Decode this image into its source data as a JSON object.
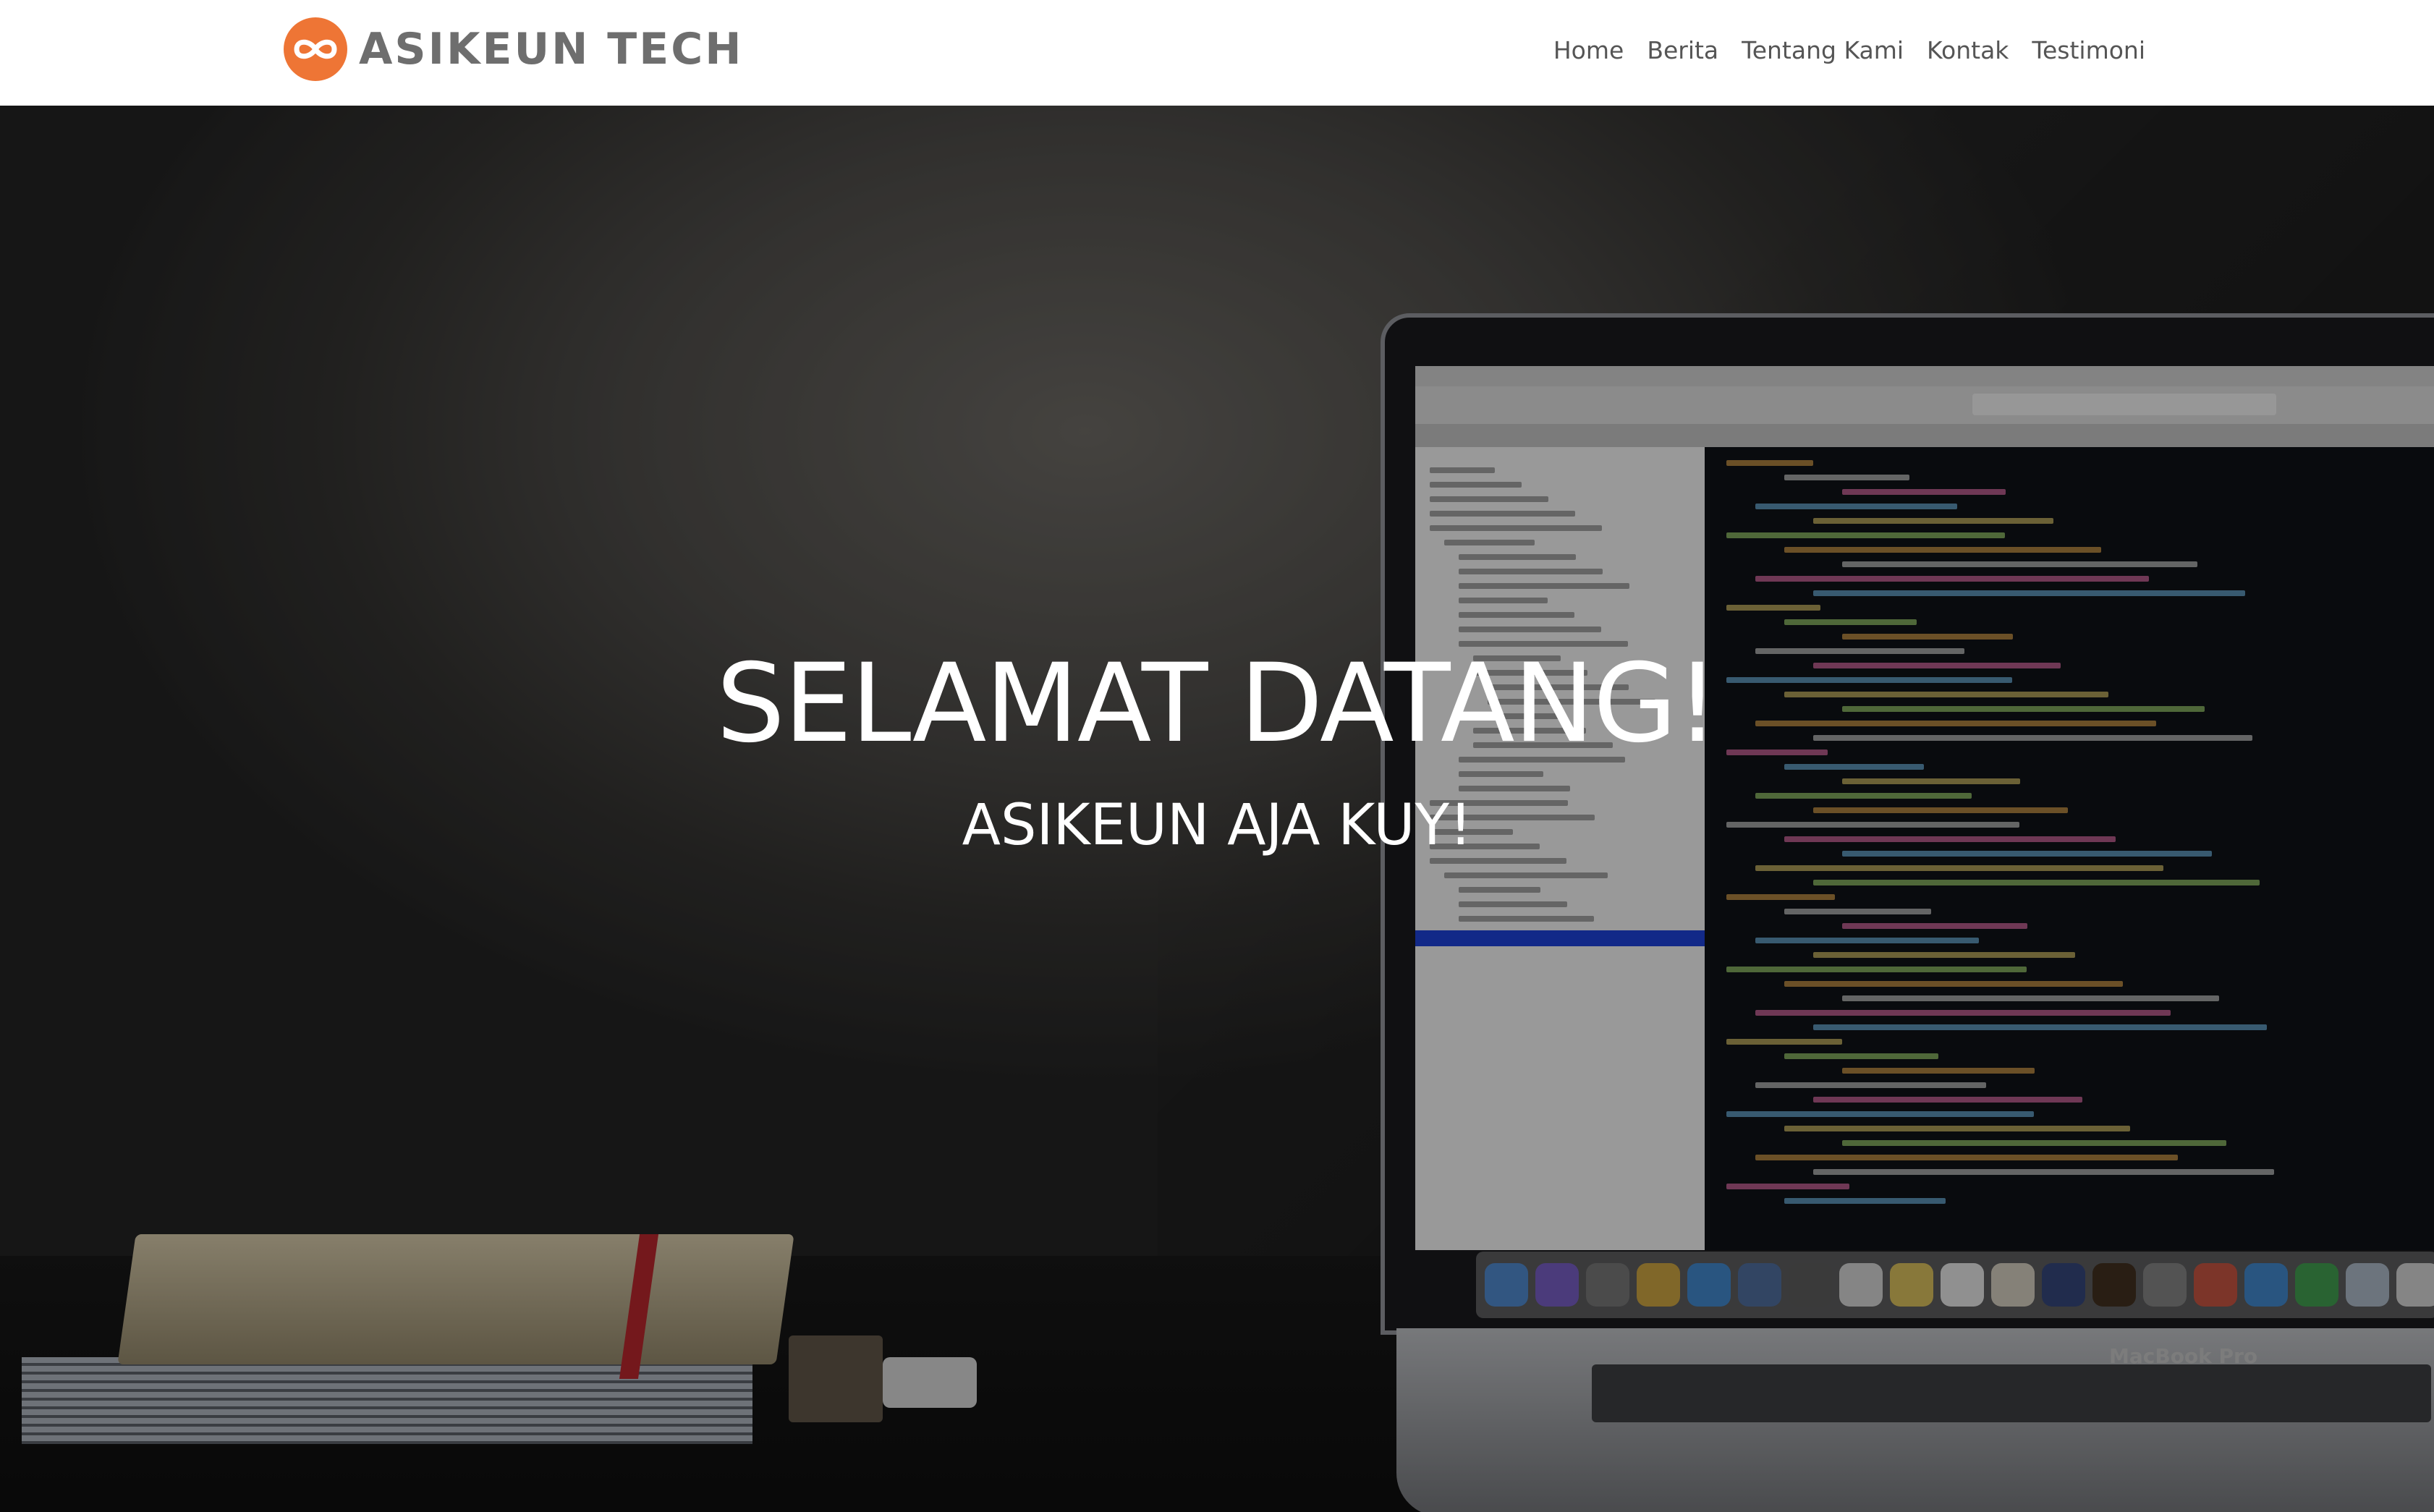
{
  "brand": {
    "name": "ASIKEUN TECH",
    "logo_icon": "infinity-icon",
    "logo_color": "#ee7535"
  },
  "nav": {
    "items": [
      {
        "label": "Home"
      },
      {
        "label": "Berita"
      },
      {
        "label": "Tentang Kami"
      },
      {
        "label": "Kontak"
      },
      {
        "label": "Testimoni"
      }
    ]
  },
  "hero": {
    "title": "SELAMAT DATANG!",
    "subtitle": "ASIKEUN AJA KUY!",
    "background": "laptop-on-desk-photo"
  },
  "laptop": {
    "brand_label": "MacBook Pro"
  }
}
